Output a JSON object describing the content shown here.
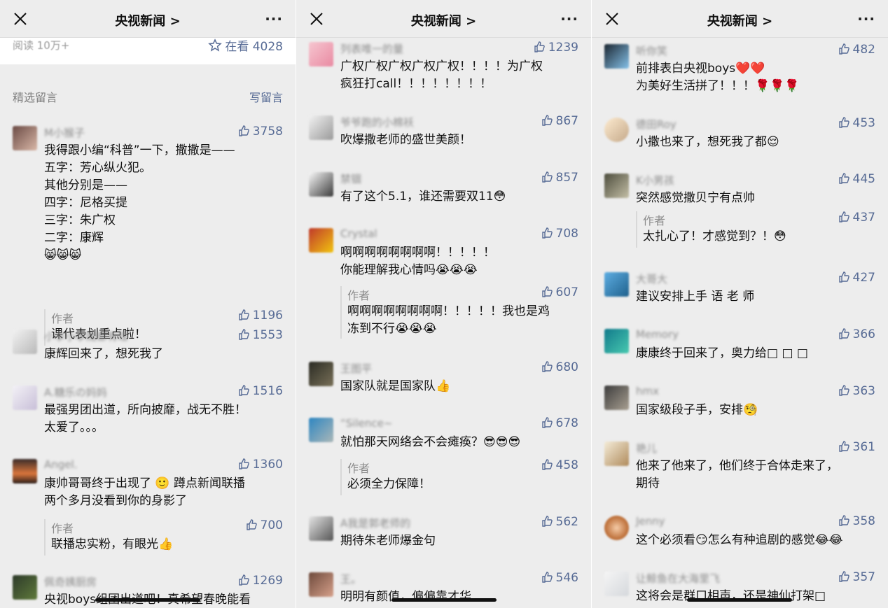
{
  "panels": [
    {
      "title": "央视新闻 >",
      "article": {
        "read": "阅读 10万+",
        "watching": "在看 4028"
      },
      "section": {
        "label": "精选留言",
        "write": "写留言"
      },
      "comments": [
        {
          "nick": "M小猴子",
          "likes": "3758",
          "text": "我得跟小编“科普”一下，撒撒是——\n五字：芳心纵火犯。\n其他分别是——\n四字：尼格买提\n三字：朱广权\n二字：康辉\n😸😸😸",
          "reply": {
            "label": "作者",
            "likes": "1196",
            "text": "课代表划重点啦！"
          }
        },
        {
          "nick": "小季小季随都有理",
          "likes": "1553",
          "text": "康辉回来了，想死我了"
        },
        {
          "nick": "A.糖乐の妈妈",
          "likes": "1516",
          "text": "最强男团出道，所向披靡，战无不胜！\n太爱了。。。"
        },
        {
          "nick": "Angel.",
          "likes": "1360",
          "text": "康帅哥哥终于出现了 🙂 蹲点新闻联播\n两个多月没看到你的身影了",
          "reply": {
            "label": "作者",
            "likes": "700",
            "text": "联播忠实粉，有眼光👍"
          }
        },
        {
          "nick": "佩奇姨厨房",
          "likes": "1269",
          "text": "央视boys组团出道吧！真希望春晚能看"
        }
      ]
    },
    {
      "title": "央视新闻 >",
      "comments": [
        {
          "nick": "列表唯一的量",
          "likes": "1239",
          "text": "广权广权广权广权广权！！！！为广权\n疯狂打call！！！！！！！！"
        },
        {
          "nick": "爷爷跑的小棉袄",
          "likes": "867",
          "text": "吹爆撒老师的盛世美颜！"
        },
        {
          "nick": "禁锢",
          "likes": "857",
          "text": "有了这个5.1，谁还需要双11😳"
        },
        {
          "nick": "Crystal",
          "likes": "708",
          "text": "啊啊啊啊啊啊啊啊！！！！！\n你能理解我心情吗😭😭😭",
          "reply": {
            "label": "作者",
            "likes": "607",
            "text": "啊啊啊啊啊啊啊啊！！！！！我也是鸡\n冻到不行😭😭😭"
          }
        },
        {
          "nick": "王图平",
          "likes": "680",
          "text": "国家队就是国家队👍"
        },
        {
          "nick": "“Silence~",
          "likes": "678",
          "text": "就怕那天网络会不会瘫痪？😎😎😎",
          "reply": {
            "label": "作者",
            "likes": "458",
            "text": "必须全力保障！"
          }
        },
        {
          "nick": "A我是郭老师的",
          "likes": "562",
          "text": "期待朱老师爆金句"
        },
        {
          "nick": "王。",
          "likes": "546",
          "text": "明明有颜值，偏偏靠才华"
        }
      ]
    },
    {
      "title": "央视新闻 >",
      "comments": [
        {
          "nick": "听你笑",
          "likes": "482",
          "text": "前排表白央视boys❤️❤️\n为美好生活拼了！！！🌹🌹🌹"
        },
        {
          "nick": "德田Roy",
          "likes": "453",
          "text": "小撒也来了，想死我了都😌"
        },
        {
          "nick": "K小男孩",
          "likes": "445",
          "text": "突然感觉撒贝宁有点帅",
          "reply": {
            "label": "作者",
            "likes": "437",
            "text": "太扎心了！才感觉到？！😳"
          }
        },
        {
          "nick": "大哥大",
          "likes": "427",
          "text": "建议安排上手 语 老 师"
        },
        {
          "nick": "Memory",
          "likes": "366",
          "text": "康康终于回来了，奥力给□ □ □"
        },
        {
          "nick": "hmx",
          "likes": "363",
          "text": "国家级段子手，安排🧐"
        },
        {
          "nick": "艳儿",
          "likes": "361",
          "text": "他来了他来了，他们终于合体走来了，\n期待"
        },
        {
          "nick": "Jenny",
          "likes": "358",
          "text": "这个必须看😏怎么有种追剧的感觉😂😂"
        },
        {
          "nick": "让鲸鱼在大海里飞",
          "likes": "357",
          "text": "这将会是群口相声，还是神仙打架□"
        }
      ]
    }
  ]
}
